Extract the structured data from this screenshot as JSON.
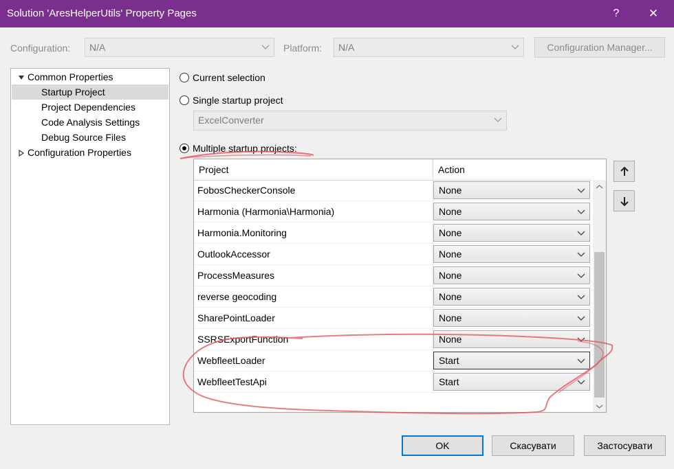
{
  "window": {
    "title": "Solution 'AresHelperUtils' Property Pages",
    "help_glyph": "?",
    "close_glyph": "✕"
  },
  "config_bar": {
    "configuration_label": "Configuration:",
    "configuration_value": "N/A",
    "platform_label": "Platform:",
    "platform_value": "N/A",
    "manager_button": "Configuration Manager..."
  },
  "tree": {
    "root_common": "Common Properties",
    "items": [
      "Startup Project",
      "Project Dependencies",
      "Code Analysis Settings",
      "Debug Source Files"
    ],
    "selected": "Startup Project",
    "root_config": "Configuration Properties"
  },
  "startup": {
    "option_current": "Current selection",
    "option_single": "Single startup project",
    "single_project_value": "ExcelConverter",
    "option_multiple": "Multiple startup projects:",
    "selected_option": "multiple"
  },
  "grid": {
    "col_project": "Project",
    "col_action": "Action",
    "rows": [
      {
        "project": "FobosCheckerConsole",
        "action": "None"
      },
      {
        "project": "Harmonia (Harmonia\\Harmonia)",
        "action": "None"
      },
      {
        "project": "Harmonia.Monitoring",
        "action": "None"
      },
      {
        "project": "OutlookAccessor",
        "action": "None"
      },
      {
        "project": "ProcessMeasures",
        "action": "None"
      },
      {
        "project": "reverse geocoding",
        "action": "None"
      },
      {
        "project": "SharePointLoader",
        "action": "None"
      },
      {
        "project": "SSRSExportFunction",
        "action": "None"
      },
      {
        "project": "WebfleetLoader",
        "action": "Start"
      },
      {
        "project": "WebfleetTestApi",
        "action": "Start"
      }
    ]
  },
  "buttons": {
    "ok": "OK",
    "cancel": "Скасувати",
    "apply": "Застосувати"
  },
  "colors": {
    "titlebar": "#7a2f8f",
    "annotation": "#e0505a"
  }
}
